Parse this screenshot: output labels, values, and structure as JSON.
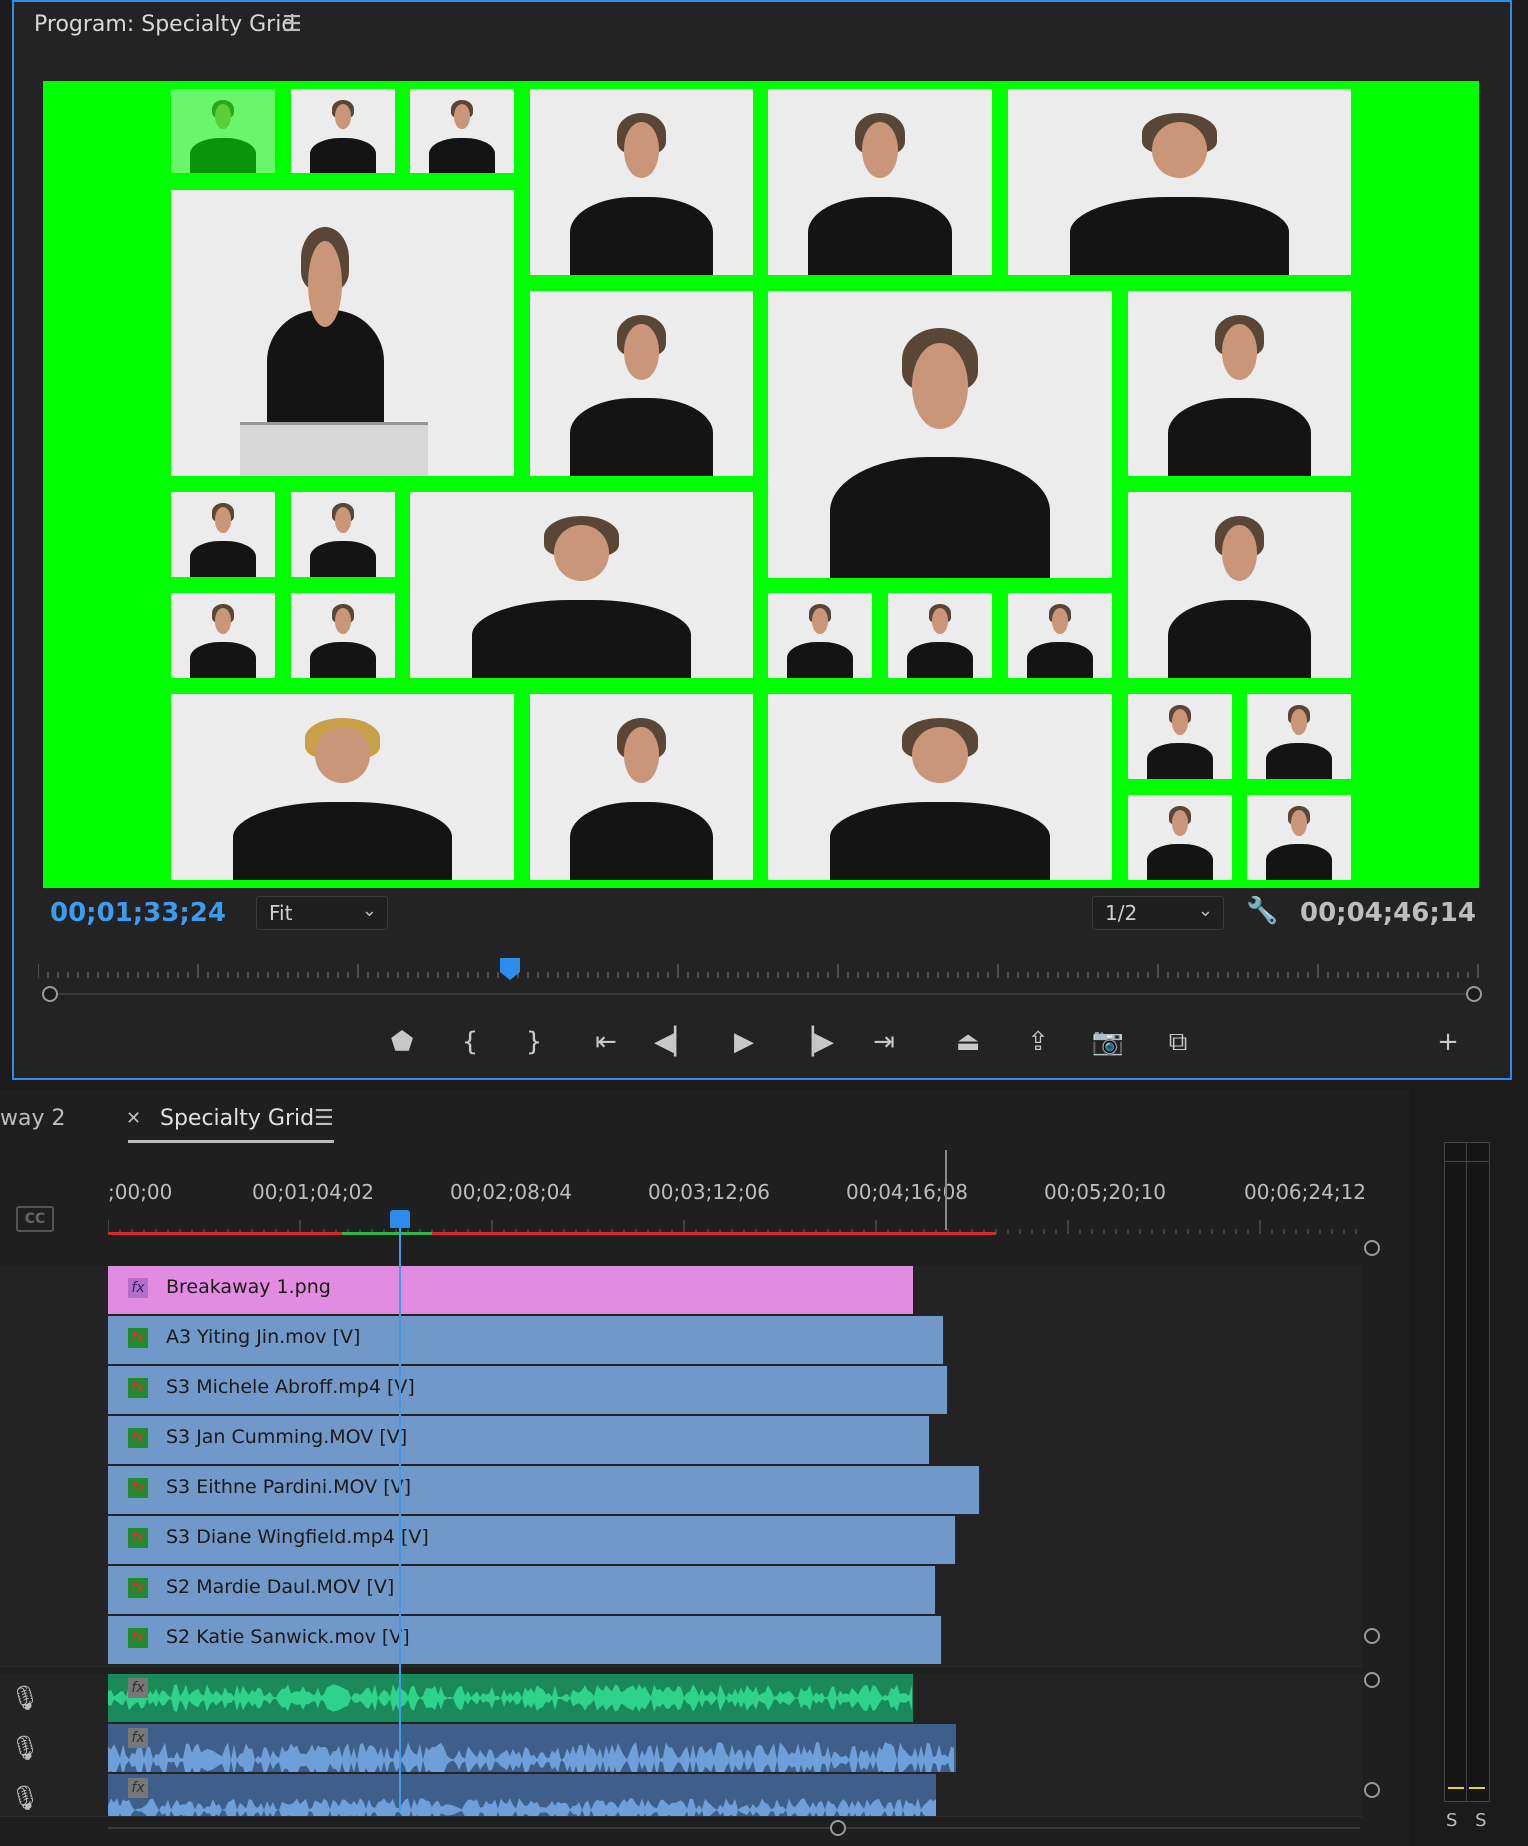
{
  "program": {
    "title": "Program: Specialty Grid",
    "menu_icon": "hamburger-icon",
    "timecode_current": "00;01;33;24",
    "zoom": "Fit",
    "resolution": "1/2",
    "timecode_duration": "00;04;46;14",
    "settings_icon": "wrench-icon"
  },
  "transport": {
    "buttons": [
      "add-marker-icon",
      "mark-in-icon",
      "mark-out-icon",
      "go-to-in-icon",
      "step-back-icon",
      "play-icon",
      "step-forward-icon",
      "go-to-out-icon",
      "lift-icon",
      "extract-icon",
      "export-frame-icon",
      "comparison-view-icon",
      "button-editor-icon"
    ]
  },
  "timeline": {
    "tab_prev": "way 2",
    "tab_active": "Specialty Grid",
    "ruler_labels": [
      ";00;00",
      "00;01;04;02",
      "00;02;08;04",
      "00;03;12;06",
      "00;04;16;08",
      "00;05;20;10",
      "00;06;24;12"
    ],
    "video_clips": [
      {
        "name": "Breakaway 1.png",
        "kind": "graphic"
      },
      {
        "name": "A3 Yiting Jin.mov [V]",
        "kind": "video"
      },
      {
        "name": "S3 Michele Abroff.mp4 [V]",
        "kind": "video"
      },
      {
        "name": "S3 Jan Cumming.MOV [V]",
        "kind": "video"
      },
      {
        "name": "S3 Eithne Pardini.MOV [V]",
        "kind": "video"
      },
      {
        "name": "S3 Diane Wingfield.mp4 [V]",
        "kind": "video"
      },
      {
        "name": "S2 Mardie Daul.MOV [V]",
        "kind": "video"
      },
      {
        "name": "S2 Katie Sanwick.mov [V]",
        "kind": "video"
      }
    ],
    "audio_tracks": 3
  },
  "meter": {
    "solo_labels": "S S"
  },
  "colors": {
    "accent": "#2d8ceb",
    "green_screen": "#00ff00",
    "video_clip": "#7098c8",
    "graphic_clip": "#e18ce0"
  }
}
